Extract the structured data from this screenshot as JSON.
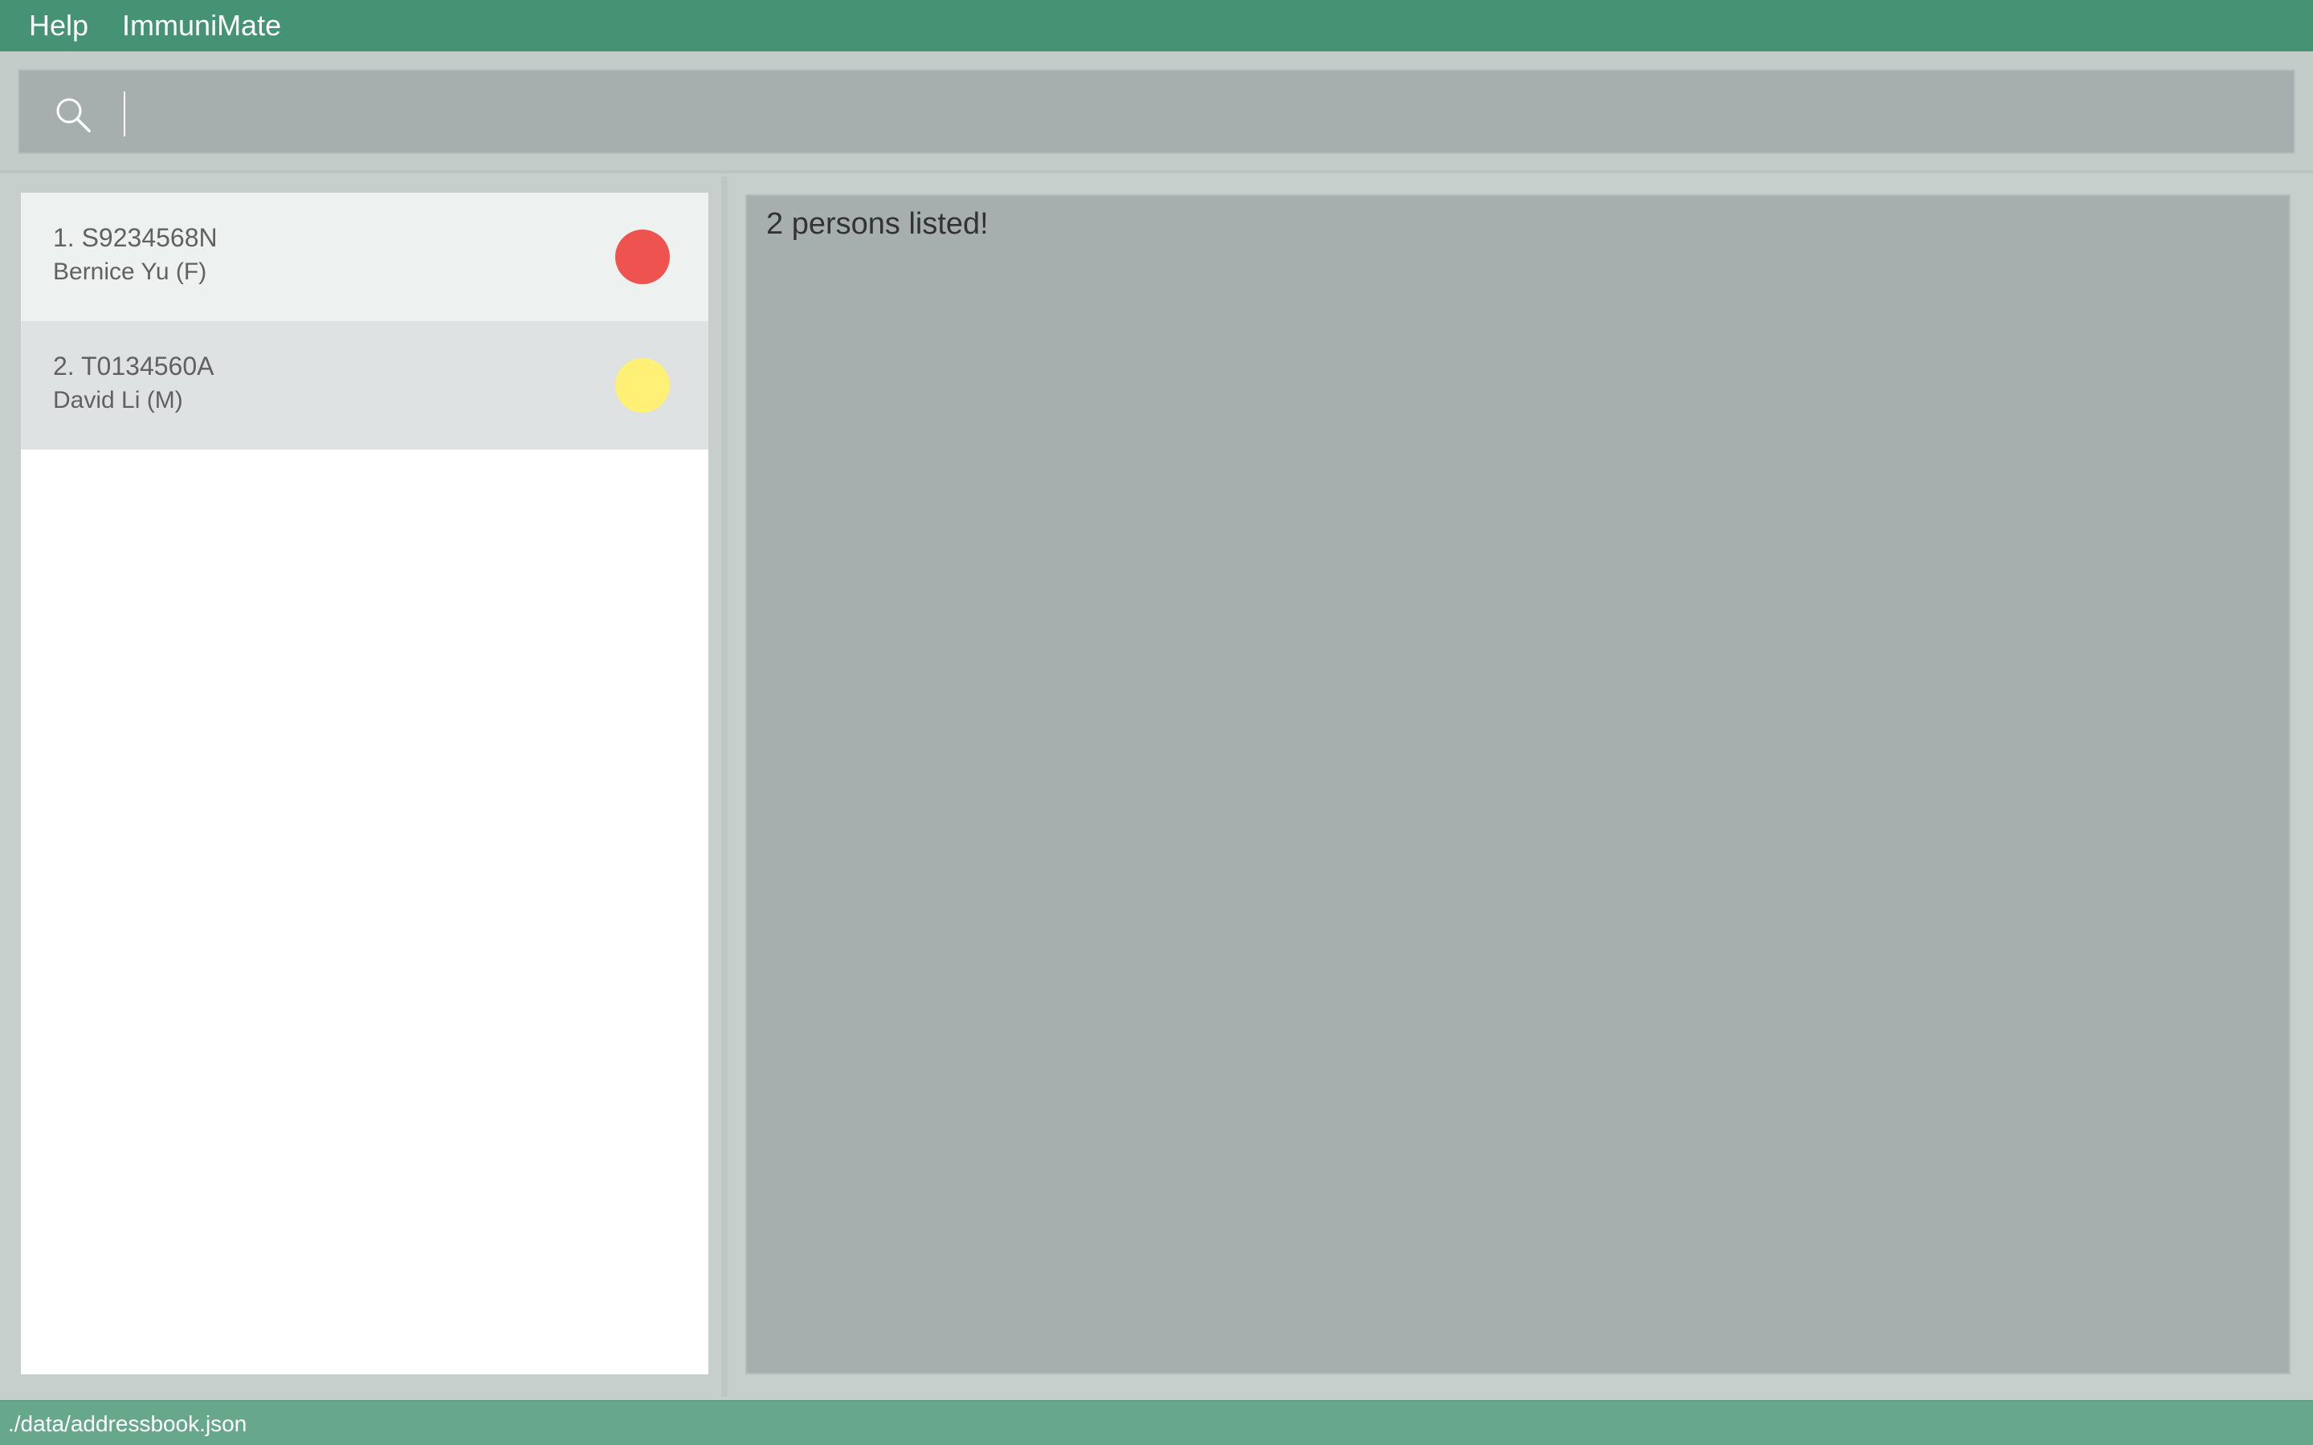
{
  "menu": {
    "items": [
      {
        "label": "Help"
      },
      {
        "label": "ImmuniMate"
      }
    ]
  },
  "command": {
    "value": "",
    "placeholder": "",
    "icon": "search-icon"
  },
  "persons": [
    {
      "id_line": "1. S9234568N",
      "name_line": "Bernice Yu (F)",
      "risk_color": "#ef5350"
    },
    {
      "id_line": "2. T0134560A",
      "name_line": "David Li (M)",
      "risk_color": "#fff176"
    }
  ],
  "result": {
    "message": "2 persons listed!"
  },
  "status": {
    "path": "./data/addressbook.json"
  },
  "colors": {
    "menubar": "#459374",
    "statusbar": "#67a88d",
    "panel": "#a6afad"
  }
}
